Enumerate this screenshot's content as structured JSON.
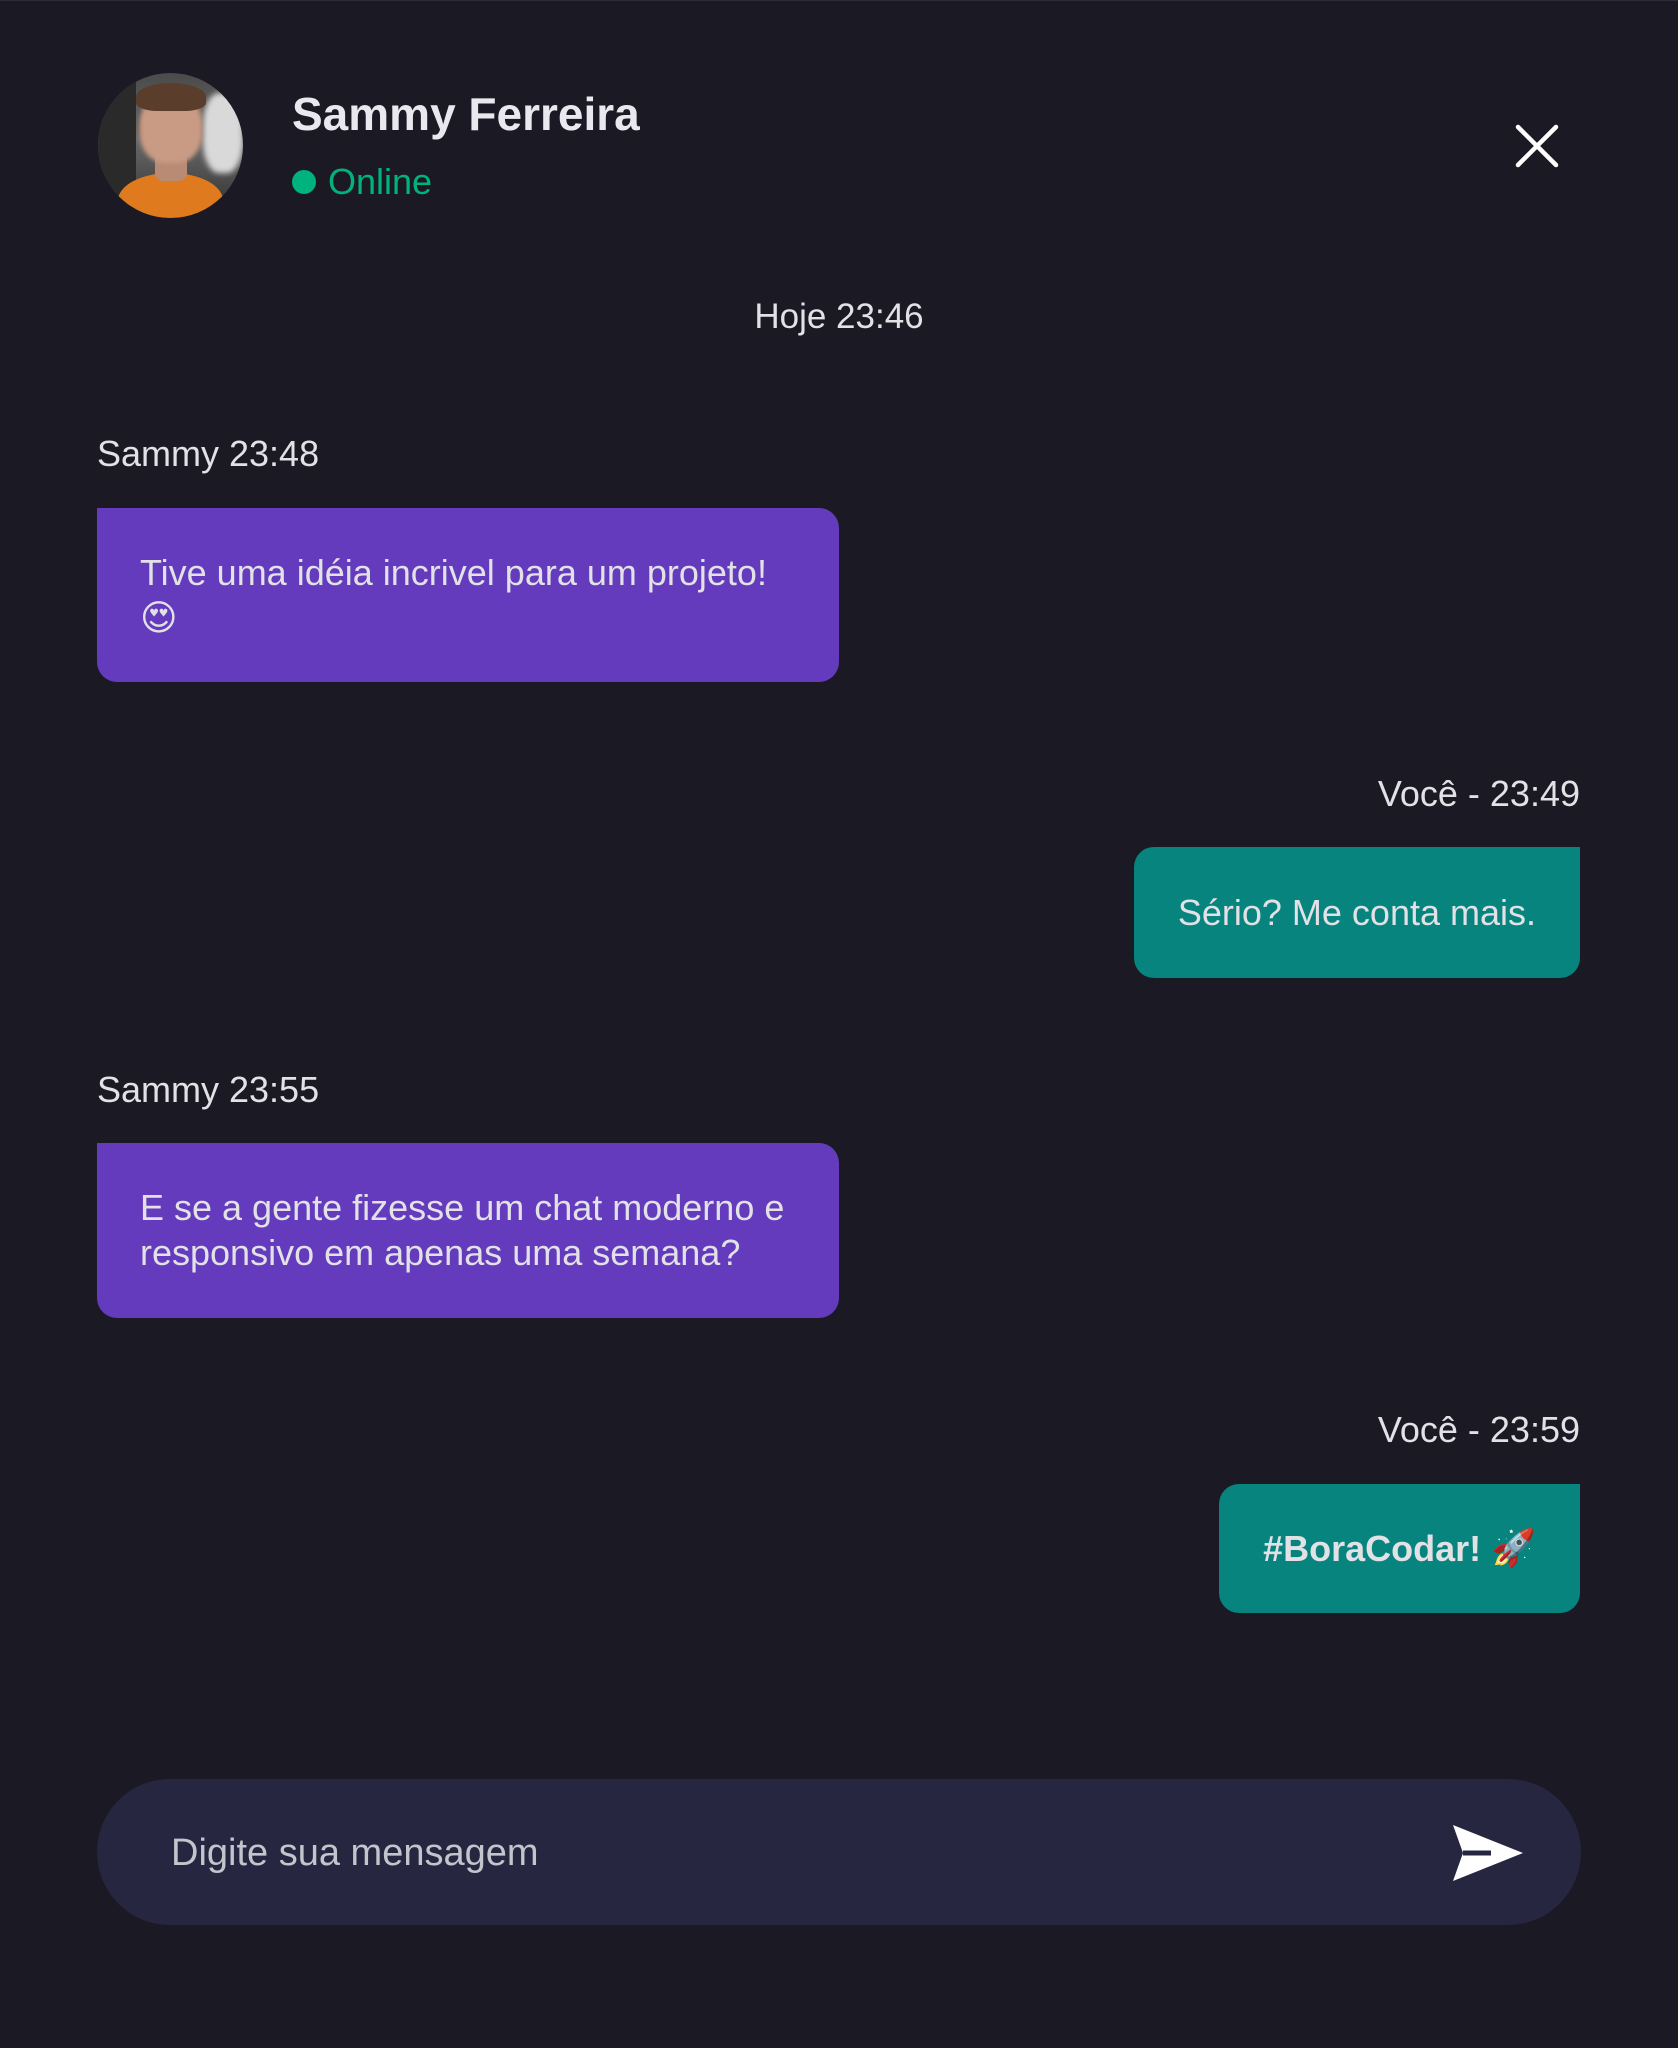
{
  "header": {
    "contact_name": "Sammy Ferreira",
    "status": "Online",
    "status_color": "#00b37e"
  },
  "day_separator": "Hoje 23:46",
  "messages": [
    {
      "from": "contact",
      "meta": "Sammy 23:48",
      "text": "Tive uma idéia incrivel para um projeto!",
      "emoji": "😍"
    },
    {
      "from": "me",
      "meta": "Você - 23:49",
      "text": "Sério? Me conta mais."
    },
    {
      "from": "contact",
      "meta": "Sammy 23:55",
      "text": "E se a gente fizesse um chat moderno e responsivo em apenas uma semana?"
    },
    {
      "from": "me",
      "meta": "Você - 23:59",
      "text": "#BoraCodar!",
      "emoji": "🚀"
    }
  ],
  "composer": {
    "placeholder": "Digite sua mensagem"
  },
  "colors": {
    "background": "#1b1a24",
    "incoming_bubble": "#633bbc",
    "outgoing_bubble": "#07847e",
    "composer": "#272640"
  },
  "icons": {
    "close": "close-icon",
    "send": "send-icon"
  }
}
